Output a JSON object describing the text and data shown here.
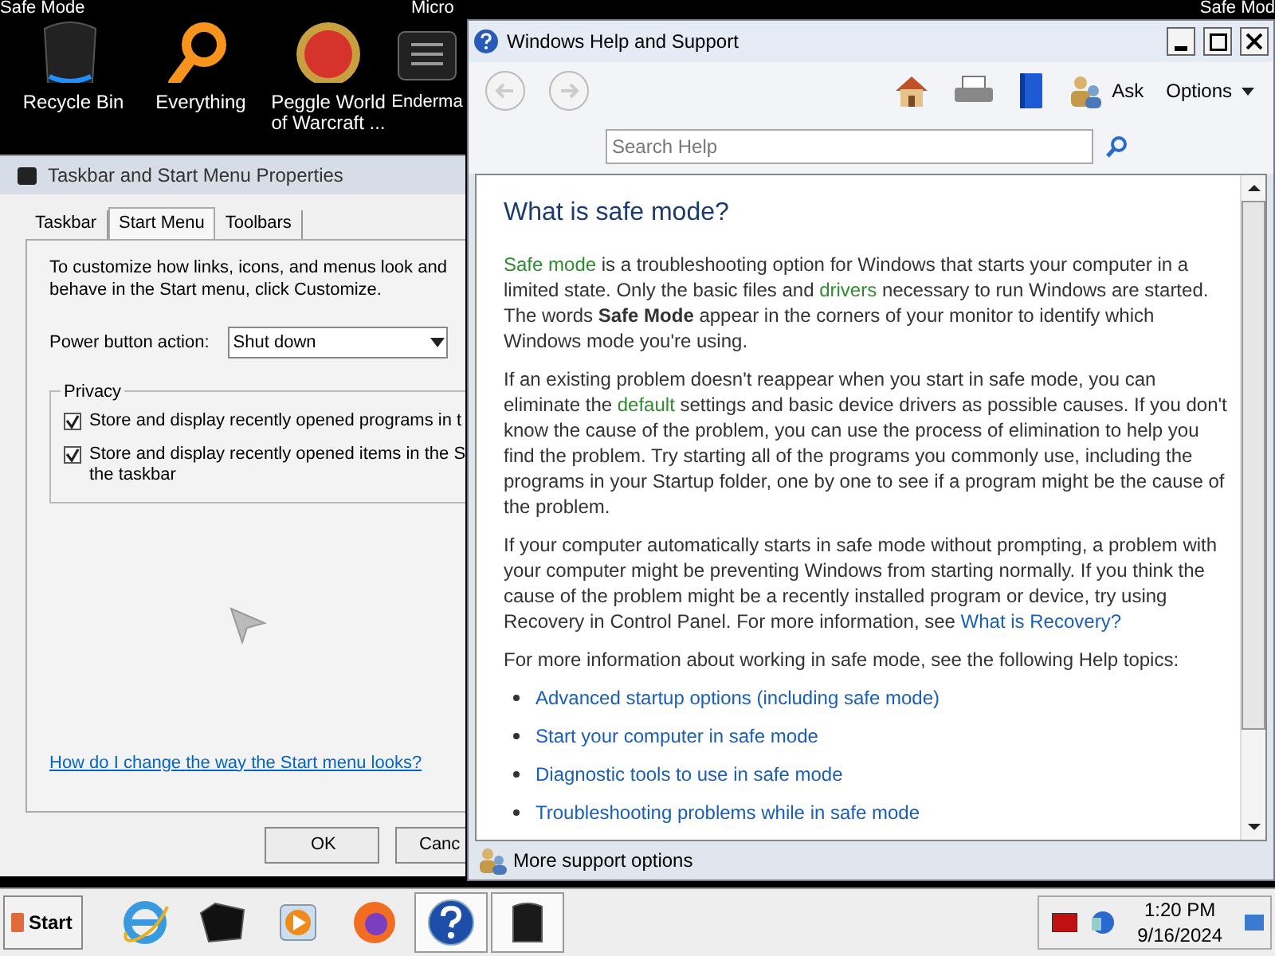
{
  "desktop": {
    "corner_texts": [
      "Safe Mode",
      "Micro",
      "Safe Mod"
    ],
    "icons": [
      {
        "kind": "bin",
        "label": "Recycle Bin"
      },
      {
        "kind": "search",
        "label": "Everything"
      },
      {
        "kind": "peggle",
        "label": "Peggle World of Warcraft ..."
      },
      {
        "kind": "monitor",
        "label": "Enderma"
      }
    ]
  },
  "dialog": {
    "title": "Taskbar and Start Menu Properties",
    "tabs": [
      {
        "label": "Taskbar",
        "selected": false
      },
      {
        "label": "Start Menu",
        "selected": true
      },
      {
        "label": "Toolbars",
        "selected": false
      }
    ],
    "intro": "To customize how links, icons, and menus look and behave in the Start menu, click Customize.",
    "power_label": "Power button action:",
    "power_value": "Shut down",
    "privacy_legend": "Privacy",
    "checkboxes": [
      {
        "lines": [
          "Store and display recently opened programs in t"
        ],
        "checked": true
      },
      {
        "lines": [
          "Store and display recently opened items in the S",
          "the taskbar"
        ],
        "checked": true
      }
    ],
    "help_link": "How do I change the way the Start menu looks?",
    "buttons": [
      "OK",
      "Canc"
    ]
  },
  "help": {
    "title": "Windows Help and Support",
    "ask": "Ask",
    "options": "Options",
    "search": {
      "placeholder": "Search Help"
    },
    "heading": "What is safe mode?",
    "paragraphs": [
      [
        {
          "kind": "term",
          "text": "Safe mode"
        },
        {
          "kind": "plain",
          "text": " is a troubleshooting option for Windows that starts your computer in a limited state. Only the basic files and "
        },
        {
          "kind": "term",
          "text": "drivers"
        },
        {
          "kind": "plain",
          "text": " necessary to run Windows are started. The words "
        },
        {
          "kind": "bold",
          "text": "Safe Mode"
        },
        {
          "kind": "plain",
          "text": " appear in the corners of your monitor to identify which Windows mode you're using."
        }
      ],
      [
        {
          "kind": "plain",
          "text": "If an existing problem doesn't reappear when you start in safe mode, you can eliminate the "
        },
        {
          "kind": "term",
          "text": "default"
        },
        {
          "kind": "plain",
          "text": " settings and basic device drivers as possible causes. If you don't know the cause of the problem, you can use the process of elimination to help you find the problem. Try starting all of the programs you commonly use, including the programs in your Startup folder, one by one to see if a program might be the cause of the problem."
        }
      ],
      [
        {
          "kind": "plain",
          "text": "If your computer automatically starts in safe mode without prompting, a problem with your computer might be preventing Windows from starting normally. If you think the cause of the problem might be a recently installed program or device, try using Recovery in Control Panel. For more information, see "
        },
        {
          "kind": "link",
          "text": "What is Recovery?"
        }
      ],
      [
        {
          "kind": "plain",
          "text": "For more information about working in safe mode, see the following Help topics:"
        }
      ]
    ],
    "topics": [
      "Advanced startup options (including safe mode)",
      "Start your computer in safe mode",
      "Diagnostic tools to use in safe mode",
      "Troubleshooting problems while in safe mode"
    ],
    "footer": "More support options"
  },
  "taskbar": {
    "start": "Start",
    "apps": [
      {
        "kind": "ie",
        "selected": false
      },
      {
        "kind": "box",
        "selected": false
      },
      {
        "kind": "media",
        "selected": false
      },
      {
        "kind": "firefox",
        "selected": false
      },
      {
        "kind": "help",
        "selected": true
      },
      {
        "kind": "monitor",
        "selected": true
      }
    ],
    "time": "1:20 PM",
    "date": "9/16/2024"
  }
}
